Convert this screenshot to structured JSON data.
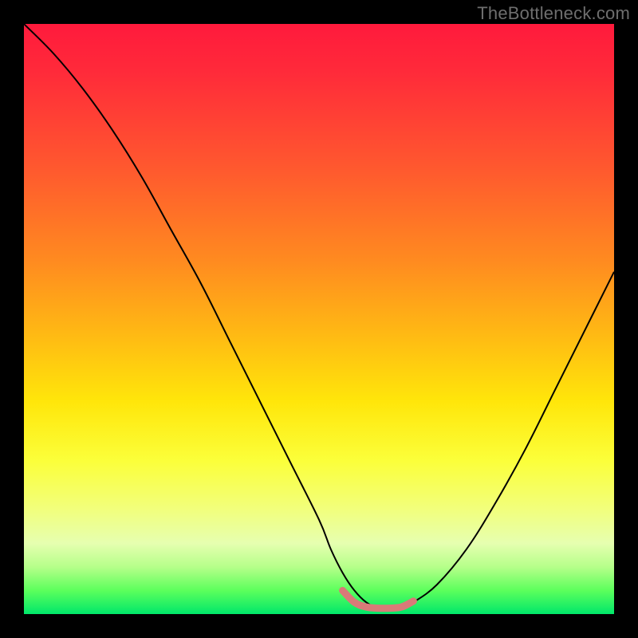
{
  "watermark": "TheBottleneck.com",
  "chart_data": {
    "type": "line",
    "title": "",
    "xlabel": "",
    "ylabel": "",
    "xlim": [
      0,
      100
    ],
    "ylim": [
      0,
      100
    ],
    "gradient_stops": [
      {
        "pos": 0,
        "color": "#ff1a3c"
      },
      {
        "pos": 25,
        "color": "#ff5a2e"
      },
      {
        "pos": 50,
        "color": "#ffb714"
      },
      {
        "pos": 70,
        "color": "#fbff3a"
      },
      {
        "pos": 90,
        "color": "#b6ff8a"
      },
      {
        "pos": 100,
        "color": "#00e76a"
      }
    ],
    "series": [
      {
        "name": "bottleneck-curve",
        "color": "#000000",
        "width": 2,
        "x": [
          0,
          5,
          10,
          15,
          20,
          25,
          30,
          35,
          40,
          45,
          50,
          52,
          54,
          56,
          58,
          60,
          62,
          64,
          66,
          70,
          75,
          80,
          85,
          90,
          95,
          100
        ],
        "y": [
          100,
          95,
          89,
          82,
          74,
          65,
          56,
          46,
          36,
          26,
          16,
          11,
          7,
          4,
          2,
          1,
          1,
          1,
          2,
          5,
          11,
          19,
          28,
          38,
          48,
          58
        ]
      },
      {
        "name": "trough-marker",
        "color": "#d97a78",
        "width": 9,
        "linecap": "round",
        "x": [
          54,
          56,
          58,
          60,
          62,
          64,
          66
        ],
        "y": [
          4,
          2,
          1.2,
          1,
          1,
          1.2,
          2.2
        ]
      }
    ]
  }
}
